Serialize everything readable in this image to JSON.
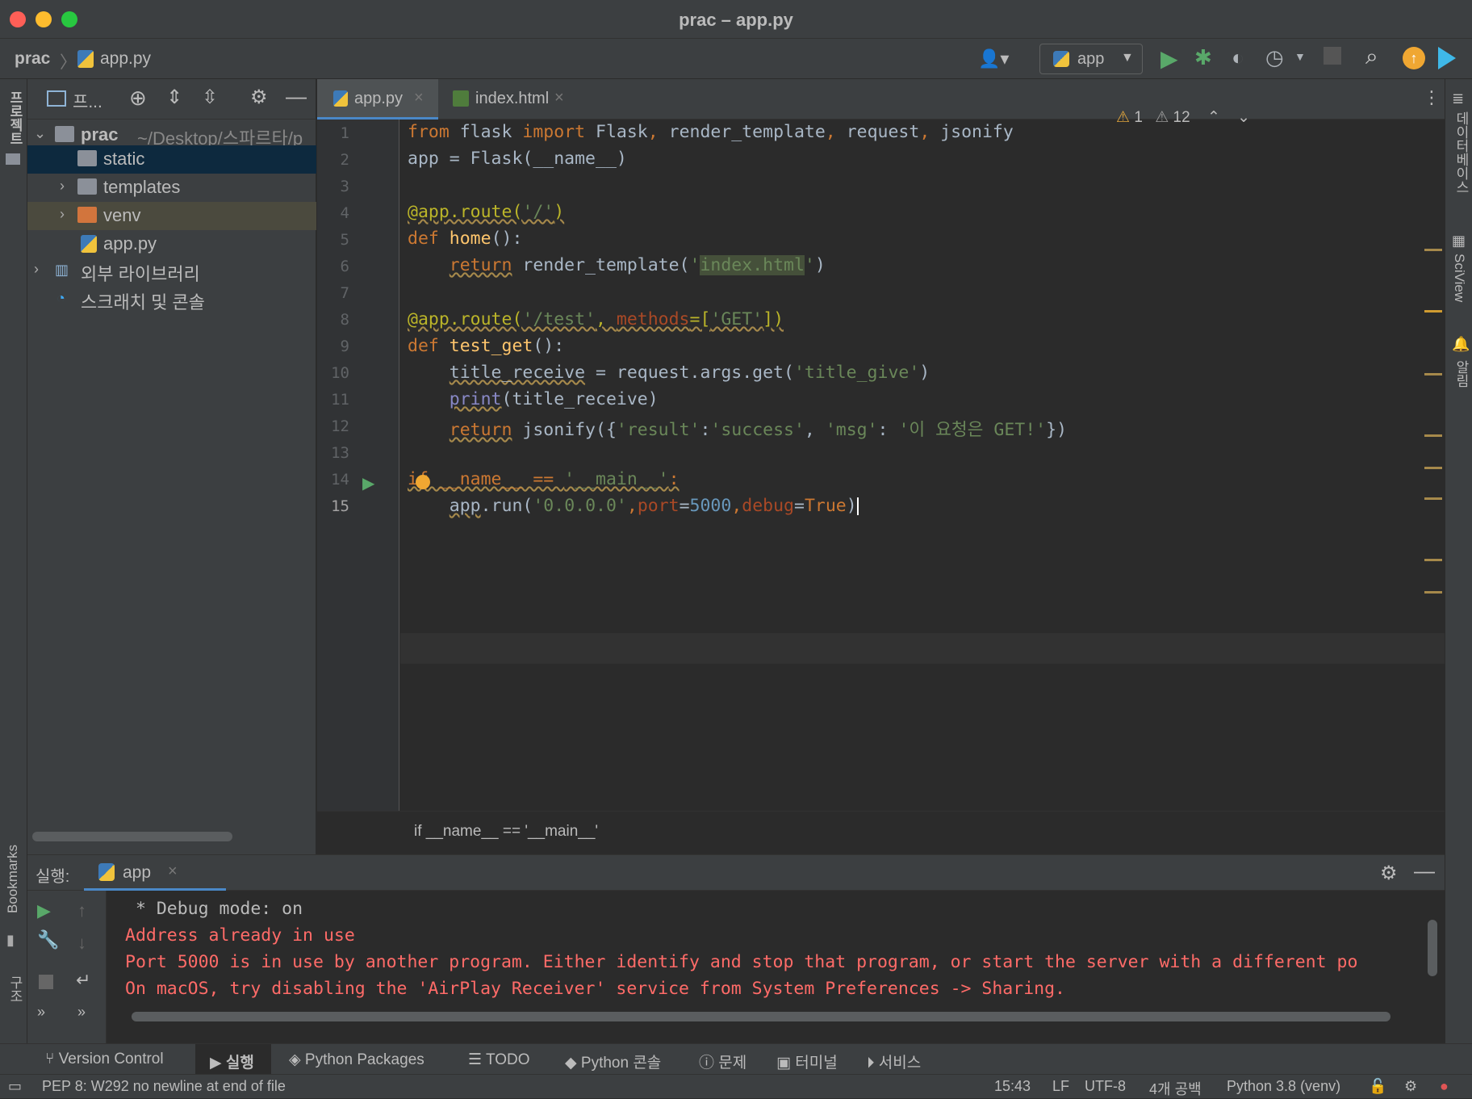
{
  "window": {
    "title": "prac – app.py"
  },
  "navbar": {
    "project": "prac",
    "file": "app.py",
    "run_config": "app"
  },
  "project_panel": {
    "title": "프...",
    "tree": [
      {
        "label": "prac",
        "path": "~/Desktop/스파르타/p",
        "type": "folder",
        "expanded": true
      },
      {
        "label": "static",
        "type": "folder"
      },
      {
        "label": "templates",
        "type": "folder"
      },
      {
        "label": "venv",
        "type": "folder-excluded"
      },
      {
        "label": "app.py",
        "type": "python-file"
      },
      {
        "label": "외부 라이브러리",
        "type": "library"
      },
      {
        "label": "스크래치 및 콘솔",
        "type": "scratch"
      }
    ]
  },
  "editor": {
    "tabs": [
      {
        "label": "app.py",
        "active": true
      },
      {
        "label": "index.html",
        "active": false
      }
    ],
    "warnings": {
      "weak": "1",
      "count": "12"
    },
    "line_numbers": [
      "1",
      "2",
      "3",
      "4",
      "5",
      "6",
      "7",
      "8",
      "9",
      "10",
      "11",
      "12",
      "13",
      "14",
      "15"
    ],
    "breadcrumb": "if __name__ == '__main__'"
  },
  "run_panel": {
    "label": "실행:",
    "tab": "app",
    "output": [
      {
        "text": " * Debug mode: on",
        "kind": "info"
      },
      {
        "text": "Address already in use",
        "kind": "error"
      },
      {
        "text": "Port 5000 is in use by another program. Either identify and stop that program, or start the server with a different po",
        "kind": "error"
      },
      {
        "text": "On macOS, try disabling the 'AirPlay Receiver' service from System Preferences -> Sharing.",
        "kind": "error"
      }
    ]
  },
  "bottom_tabs": [
    "Version Control",
    "실행",
    "Python Packages",
    "TODO",
    "Python 콘솔",
    "문제",
    "터미널",
    "서비스"
  ],
  "status": {
    "message": "PEP 8: W292 no newline at end of file",
    "position": "15:43",
    "line_sep": "LF",
    "encoding": "UTF-8",
    "indent": "4개 공백",
    "interpreter": "Python 3.8 (venv)"
  },
  "side_labels": {
    "left_top": "프로젝트",
    "left_bookmarks": "Bookmarks",
    "left_structure": "구조",
    "right_db": "데이터베이스",
    "right_sciview": "SciView",
    "right_notify": "알림"
  }
}
